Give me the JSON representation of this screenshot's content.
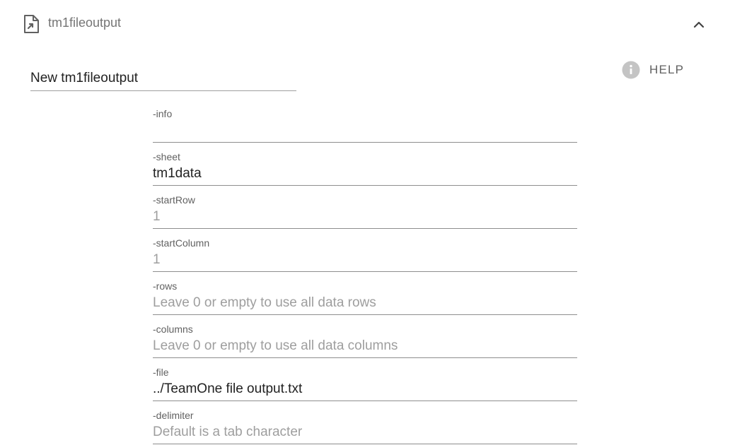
{
  "header": {
    "title": "tm1fileoutput",
    "icon": "file-export-icon",
    "collapse_icon": "chevron-up-icon"
  },
  "name_field": {
    "value": "New tm1fileoutput"
  },
  "help": {
    "label": "HELP",
    "icon": "info-icon"
  },
  "fields": [
    {
      "label": "-info",
      "value": "",
      "placeholder": ""
    },
    {
      "label": "-sheet",
      "value": "tm1data",
      "placeholder": ""
    },
    {
      "label": "-startRow",
      "value": "",
      "placeholder": "1"
    },
    {
      "label": "-startColumn",
      "value": "",
      "placeholder": "1"
    },
    {
      "label": "-rows",
      "value": "",
      "placeholder": "Leave 0 or empty to use all data rows"
    },
    {
      "label": "-columns",
      "value": "",
      "placeholder": "Leave 0 or empty to use all data columns"
    },
    {
      "label": "-file",
      "value": "../TeamOne file output.txt",
      "placeholder": ""
    },
    {
      "label": "-delimiter",
      "value": "",
      "placeholder": "Default is a tab character"
    }
  ],
  "colors": {
    "text": "#212121",
    "muted": "#757575",
    "placeholder": "#9e9e9e",
    "divider": "#8e8e8e",
    "help_icon": "#bdbdbd"
  }
}
